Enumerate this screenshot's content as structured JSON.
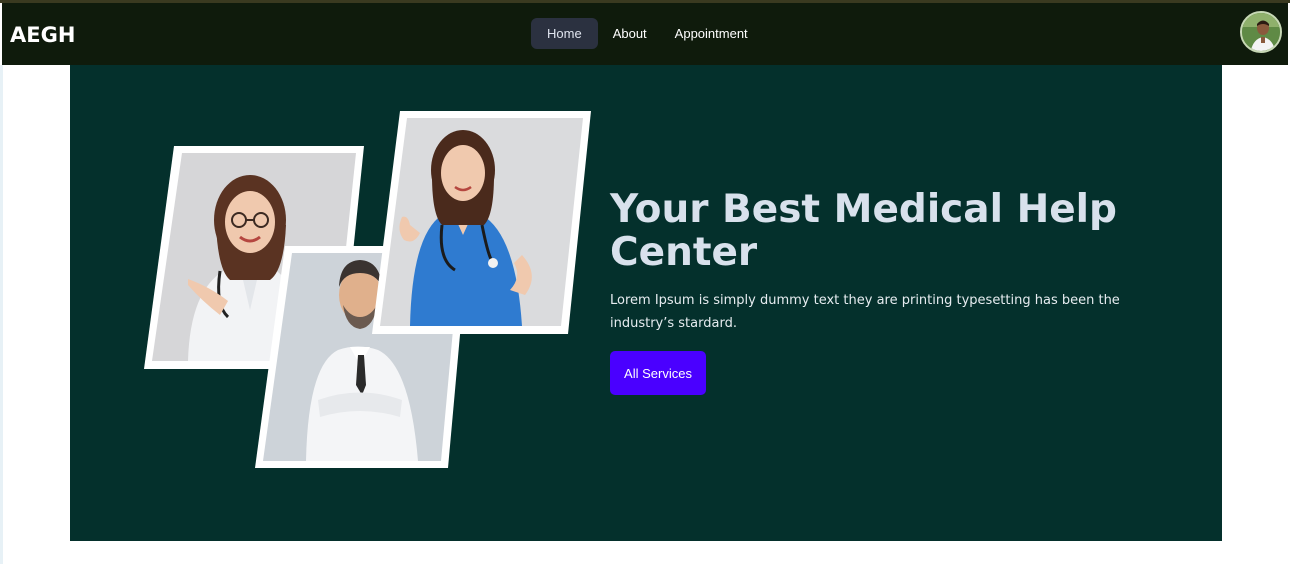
{
  "brand": "AEGH",
  "nav": {
    "items": [
      {
        "label": "Home",
        "active": true
      },
      {
        "label": "About",
        "active": false
      },
      {
        "label": "Appointment",
        "active": false
      }
    ]
  },
  "hero": {
    "title": "Your Best Medical Help Center",
    "description": "Lorem Ipsum is simply dummy text they are printing typesetting has been the industry’s stardard.",
    "cta_label": "All Services"
  },
  "colors": {
    "navbar_bg": "#0f1b0c",
    "hero_bg": "#04302c",
    "cta_bg": "#4a00ff",
    "active_nav_bg": "#2b3140"
  },
  "icons": {
    "avatar": "user-avatar"
  },
  "images": [
    "doctor-woman-glasses-photo",
    "doctor-man-white-coat-photo",
    "nurse-blue-scrubs-photo"
  ]
}
